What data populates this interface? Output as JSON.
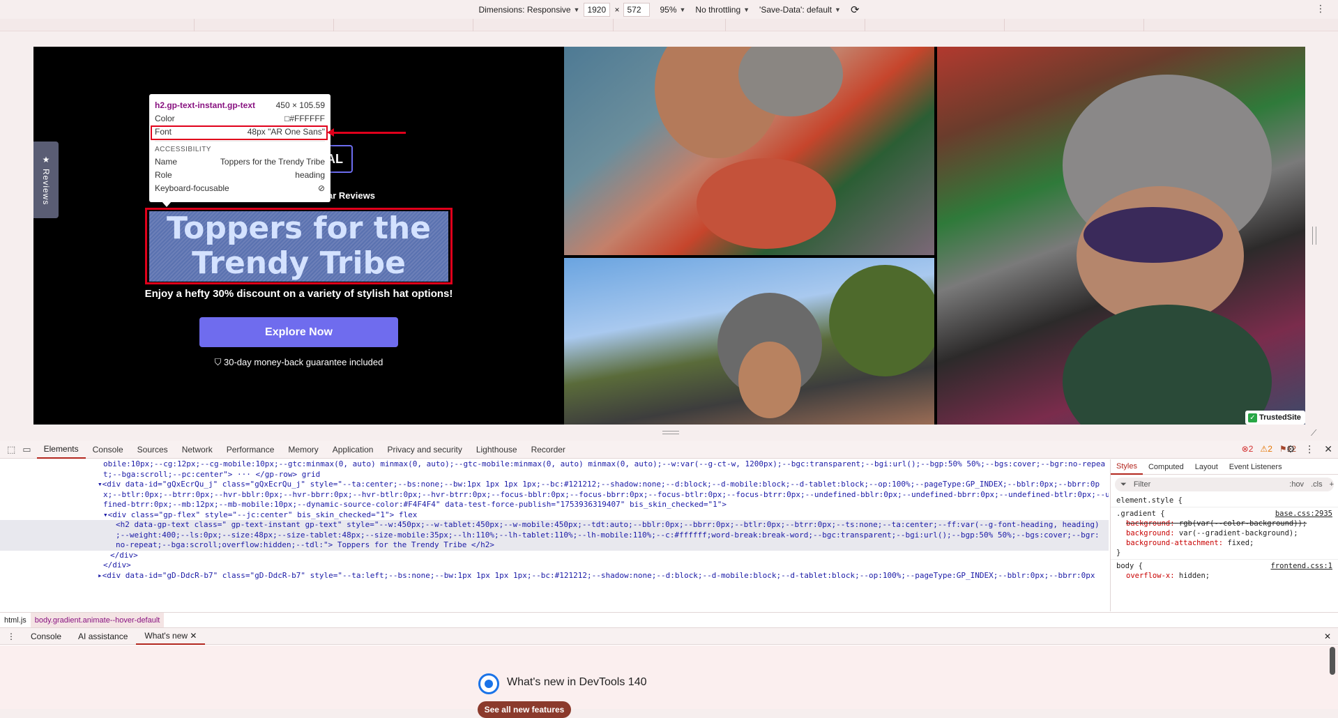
{
  "toolbar": {
    "dimensions_label": "Dimensions: Responsive",
    "width": "1920",
    "height": "572",
    "zoom": "95%",
    "throttling": "No throttling",
    "save_data": "'Save-Data': default"
  },
  "page": {
    "reviews_tab": "Reviews",
    "badge_partial": "AL",
    "stars_text": "ar Reviews",
    "heading_line1": "Toppers for the",
    "heading_line2": "Trendy Tribe",
    "subtitle": "Enjoy a hefty 30% discount on a variety of stylish hat options!",
    "cta": "Explore Now",
    "guarantee": "30-day money-back guarantee included",
    "trusted": "TrustedSite"
  },
  "tooltip": {
    "selector": "h2.gp-text-instant.gp-text",
    "size": "450 × 105.59",
    "color_label": "Color",
    "color_value": "#FFFFFF",
    "font_label": "Font",
    "font_value": "48px \"AR One Sans\"",
    "accessibility_label": "ACCESSIBILITY",
    "name_label": "Name",
    "name_value": "Toppers for the Trendy Tribe",
    "role_label": "Role",
    "role_value": "heading",
    "focus_label": "Keyboard-focusable"
  },
  "devtools": {
    "tabs": [
      "Elements",
      "Console",
      "Sources",
      "Network",
      "Performance",
      "Memory",
      "Application",
      "Privacy and security",
      "Lighthouse",
      "Recorder"
    ],
    "errors": "2",
    "warnings": "2",
    "issues": "12",
    "code_lines": [
      "obile:10px;--cg:12px;--cg-mobile:10px;--gtc:minmax(0, auto) minmax(0, auto);--gtc-mobile:minmax(0, auto) minmax(0, auto);--w:var(--g-ct-w, 1200px);--bgc:transparent;--bgi:url();--bgp:50% 50%;--bgs:cover;--bgr:no-repea",
      "t;--bga:scroll;--pc:center\"> ··· </gp-row> grid",
      "▾<div data-id=\"gQxEcrQu_j\" class=\"gQxEcrQu_j\" style=\"--ta:center;--bs:none;--bw:1px 1px 1px 1px;--bc:#121212;--shadow:none;--d:block;--d-mobile:block;--d-tablet:block;--op:100%;--pageType:GP_INDEX;--bblr:0px;--bbrr:0p",
      "x;--btlr:0px;--btrr:0px;--hvr-bblr:0px;--hvr-bbrr:0px;--hvr-btlr:0px;--hvr-btrr:0px;--focus-bblr:0px;--focus-bbrr:0px;--focus-btlr:0px;--focus-btrr:0px;--undefined-bblr:0px;--undefined-bbrr:0px;--undefined-btlr:0px;--unde",
      "fined-btrr:0px;--mb:12px;--mb-mobile:10px;--dynamic-source-color:#F4F4F4\" data-test-force-publish=\"1753936319407\" bis_skin_checked=\"1\">",
      "▾<div class=\"gp-flex\" style=\"--jc:center\" bis_skin_checked=\"1\"> flex",
      "<h2 data-gp-text class=\" gp-text-instant gp-text\" style=\"--w:450px;--w-tablet:450px;--w-mobile:450px;--tdt:auto;--bblr:0px;--bbrr:0px;--btlr:0px;--btrr:0px;--ts:none;--ta:center;--ff:var(--g-font-heading, heading)",
      ";--weight:400;--ls:0px;--size:48px;--size-tablet:48px;--size-mobile:35px;--lh:110%;--lh-tablet:110%;--lh-mobile:110%;--c:#ffffff;word-break:break-word;--bgc:transparent;--bgi:url();--bgp:50% 50%;--bgs:cover;--bgr:",
      "no-repeat;--bga:scroll;overflow:hidden;--tdl:\"> Toppers for the Trendy Tribe </h2>",
      "</div>",
      "</div>",
      "▸<div data-id=\"gD-DdcR-b7\" class=\"gD-DdcR-b7\" style=\"--ta:left;--bs:none;--bw:1px 1px 1px 1px;--bc:#121212;--shadow:none;--d:block;--d-mobile:block;--d-tablet:block;--op:100%;--pageType:GP_INDEX;--bblr:0px;--bbrr:0px"
    ],
    "styles_tabs": [
      "Styles",
      "Computed",
      "Layout",
      "Event Listeners"
    ],
    "filter_placeholder": "Filter",
    "filter_hov": ":hov",
    "filter_cls": ".cls",
    "rules": {
      "element_style": "element.style {",
      "gradient_selector": ".gradient {",
      "gradient_src": "base.css:2935",
      "gradient_p1": "background:",
      "gradient_v1": "rgb(var(--color-background));",
      "gradient_p2": "background:",
      "gradient_v2": "var(--gradient-background);",
      "gradient_p3": "background-attachment:",
      "gradient_v3": "fixed;",
      "body_selector": "body {",
      "body_src": "frontend.css:1",
      "body_p1": "overflow-x:",
      "body_v1": "hidden;",
      "close_brace": "}"
    },
    "breadcrumbs": [
      "html.js",
      "body.gradient.animate--hover-default"
    ],
    "drawer_tabs": [
      "Console",
      "AI assistance",
      "What's new"
    ],
    "whats_new_title": "What's new in DevTools 140",
    "whats_new_button": "See all new features"
  },
  "colors": {
    "accent": "#6f6cee",
    "highlight_red": "#e0001b",
    "devtools_accent": "#b3261e"
  }
}
